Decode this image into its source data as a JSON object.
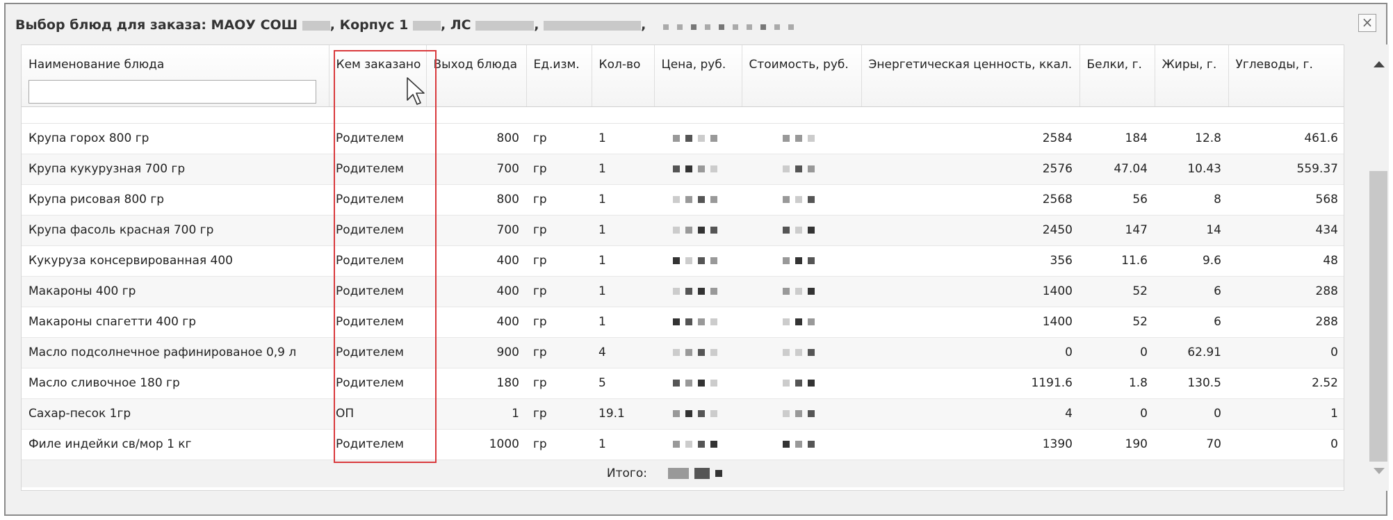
{
  "dialog": {
    "title_prefix": "Выбор блюд для заказа: МАОУ СОШ",
    "title_building": ", Корпус 1",
    "title_account": ", ЛС",
    "close_symbol": "×"
  },
  "columns": {
    "name": "Наименование блюда",
    "ordered_by": "Кем заказано",
    "yield": "Выход блюда",
    "unit": "Ед.изм.",
    "qty": "Кол-во",
    "price": "Цена, руб.",
    "cost": "Стоимость, руб.",
    "energy": "Энергетическая ценность, ккал.",
    "protein": "Белки, г.",
    "fat": "Жиры, г.",
    "carbs": "Углеводы, г."
  },
  "filter": {
    "name_value": "",
    "name_placeholder": ""
  },
  "rows": [
    {
      "name": "Крупа горох 800 гр",
      "ordered_by": "Родителем",
      "yield": "800",
      "unit": "гр",
      "qty": "1",
      "energy": "2584",
      "protein": "184",
      "fat": "12.8",
      "carbs": "461.6"
    },
    {
      "name": "Крупа кукурузная 700 гр",
      "ordered_by": "Родителем",
      "yield": "700",
      "unit": "гр",
      "qty": "1",
      "energy": "2576",
      "protein": "47.04",
      "fat": "10.43",
      "carbs": "559.37"
    },
    {
      "name": "Крупа рисовая 800 гр",
      "ordered_by": "Родителем",
      "yield": "800",
      "unit": "гр",
      "qty": "1",
      "energy": "2568",
      "protein": "56",
      "fat": "8",
      "carbs": "568"
    },
    {
      "name": "Крупа фасоль красная 700 гр",
      "ordered_by": "Родителем",
      "yield": "700",
      "unit": "гр",
      "qty": "1",
      "energy": "2450",
      "protein": "147",
      "fat": "14",
      "carbs": "434"
    },
    {
      "name": "Кукуруза консервированная 400",
      "ordered_by": "Родителем",
      "yield": "400",
      "unit": "гр",
      "qty": "1",
      "energy": "356",
      "protein": "11.6",
      "fat": "9.6",
      "carbs": "48"
    },
    {
      "name": "Макароны 400 гр",
      "ordered_by": "Родителем",
      "yield": "400",
      "unit": "гр",
      "qty": "1",
      "energy": "1400",
      "protein": "52",
      "fat": "6",
      "carbs": "288"
    },
    {
      "name": "Макароны спагетти 400 гр",
      "ordered_by": "Родителем",
      "yield": "400",
      "unit": "гр",
      "qty": "1",
      "energy": "1400",
      "protein": "52",
      "fat": "6",
      "carbs": "288"
    },
    {
      "name": "Масло подсолнечное рафинированое 0,9 л",
      "ordered_by": "Родителем",
      "yield": "900",
      "unit": "гр",
      "qty": "4",
      "energy": "0",
      "protein": "0",
      "fat": "62.91",
      "carbs": "0"
    },
    {
      "name": "Масло сливочное 180 гр",
      "ordered_by": "Родителем",
      "yield": "180",
      "unit": "гр",
      "qty": "5",
      "energy": "1191.6",
      "protein": "1.8",
      "fat": "130.5",
      "carbs": "2.52"
    },
    {
      "name": "Сахар-песок 1гр",
      "ordered_by": "ОП",
      "yield": "1",
      "unit": "гр",
      "qty": "19.1",
      "energy": "4",
      "protein": "0",
      "fat": "0",
      "carbs": "1"
    },
    {
      "name": "Филе индейки св/мор 1 кг",
      "ordered_by": "Родителем",
      "yield": "1000",
      "unit": "гр",
      "qty": "1",
      "energy": "1390",
      "protein": "190",
      "fat": "70",
      "carbs": "0"
    }
  ],
  "footer": {
    "total_label": "Итого:"
  },
  "annotation": {
    "highlight_color": "#d9393c"
  }
}
